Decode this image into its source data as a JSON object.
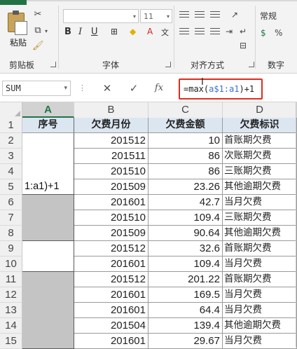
{
  "ribbon": {
    "clipboard_group": "剪贴板",
    "paste_label": "粘贴",
    "font_group": "字体",
    "font_size": "11",
    "align_group": "对齐方式",
    "number_group": "数字",
    "number_format": "常规"
  },
  "formula_bar": {
    "name_box": "SUM",
    "formula_prefix": "=max(",
    "formula_ref": "a$1:a1",
    "formula_suffix": ")+1",
    "cancel_icon": "✕",
    "enter_icon": "✓",
    "fx_label": "fx"
  },
  "grid": {
    "columns": [
      "A",
      "B",
      "C",
      "D"
    ],
    "selected_column": "A",
    "header_row": [
      "序号",
      "欠费月份",
      "欠费金额",
      "欠费标识"
    ],
    "row_numbers": [
      "1",
      "2",
      "3",
      "4",
      "5",
      "6",
      "7",
      "8",
      "9",
      "10",
      "11",
      "12",
      "13",
      "14",
      "15"
    ],
    "rows": [
      {
        "month": "201512",
        "amount": "10",
        "flag": "首账期欠费"
      },
      {
        "month": "201511",
        "amount": "86",
        "flag": "次账期欠费"
      },
      {
        "month": "201510",
        "amount": "86",
        "flag": "三账期欠费"
      },
      {
        "month": "201509",
        "amount": "23.26",
        "flag": "其他逾期欠费"
      },
      {
        "month": "201601",
        "amount": "42.7",
        "flag": "当月欠费"
      },
      {
        "month": "201510",
        "amount": "109.4",
        "flag": "三账期欠费"
      },
      {
        "month": "201509",
        "amount": "90.64",
        "flag": "其他逾期欠费"
      },
      {
        "month": "201512",
        "amount": "32.6",
        "flag": "首账期欠费"
      },
      {
        "month": "201601",
        "amount": "109.4",
        "flag": "当月欠费"
      },
      {
        "month": "201512",
        "amount": "201.22",
        "flag": "首账期欠费"
      },
      {
        "month": "201601",
        "amount": "169.5",
        "flag": "当月欠费"
      },
      {
        "month": "201601",
        "amount": "64.4",
        "flag": "当月欠费"
      },
      {
        "month": "201504",
        "amount": "139.4",
        "flag": "其他逾期欠费"
      },
      {
        "month": "201601",
        "amount": "29.67",
        "flag": "当月欠费"
      }
    ],
    "a_edit_text": "1:a1)+1"
  }
}
